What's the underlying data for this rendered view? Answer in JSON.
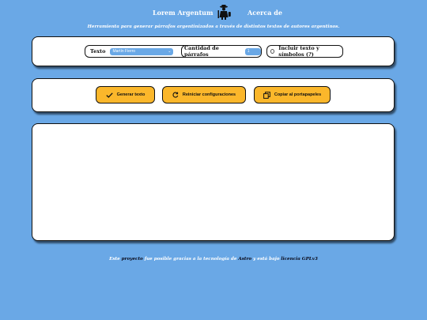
{
  "header": {
    "title": "Lorem Argentum",
    "logo_icon": "gaucho-figure-icon",
    "about_link": "Acerca de"
  },
  "tagline": "Herramienta para generar párrafos argentinizados a través de distintos textos de autores argentinos.",
  "config": {
    "text_label": "Texto",
    "text_selected": "Martín Fierro",
    "count_label": "Cantidad de párrafos",
    "count_value": "1",
    "symbols_label": "Incluir texto y símbolos (?)"
  },
  "actions": {
    "generate_label": "Generar texto",
    "reset_label": "Reiniciar configuraciones",
    "copy_label": "Copiar al portapapeles"
  },
  "output": {
    "content": ""
  },
  "footer": {
    "prefix": "Este ",
    "project_link": "proyecto",
    "middle": " fue posible gracias a la tecnología de ",
    "astro_link": "Astro",
    "suffix": " y está bajo ",
    "license_link": "licencia GPLv3"
  },
  "colors": {
    "background": "#6aa8e6",
    "button": "#fbb72b",
    "panel": "#ffffff"
  }
}
